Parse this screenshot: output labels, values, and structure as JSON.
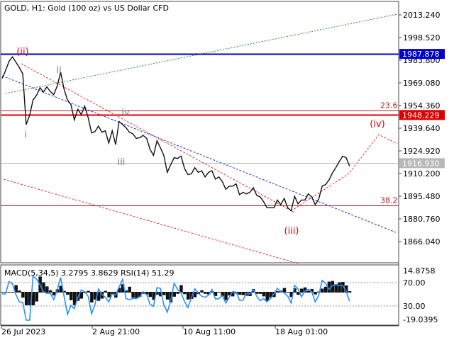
{
  "header": {
    "title": "GOLD, H1:  Gold (100 oz) vs US Dollar CFD"
  },
  "chart_data": [
    {
      "type": "line",
      "title": "GOLD, H1:  Gold (100 oz) vs US Dollar CFD",
      "ylim": [
        1856.0,
        2020.0
      ],
      "y_ticks": [
        "2013.240",
        "1998.520",
        "1983.800",
        "1969.080",
        "1954.360",
        "1939.640",
        "1924.920",
        "1910.200",
        "1895.480",
        "1880.760",
        "1866.040"
      ],
      "x_ticks": [
        "26 Jul 2023",
        "2 Aug 21:00",
        "10 Aug 11:00",
        "18 Aug 01:00"
      ],
      "price_tags": [
        {
          "label": "1987.878",
          "value": 1987.878,
          "color": "#0000cc"
        },
        {
          "label": "1948.229",
          "value": 1948.229,
          "color": "#dd0000"
        },
        {
          "label": "1916.930",
          "value": 1916.93,
          "color": "#b8b8b8"
        }
      ],
      "levels": [
        {
          "label": "23.6",
          "value": 1951.2
        },
        {
          "label": "38.2",
          "value": 1889.6
        }
      ],
      "wave_labels": [
        {
          "text": "(ii)",
          "color": "#dd0000"
        },
        {
          "text": "ii",
          "color": "#777777"
        },
        {
          "text": "i",
          "color": "#777777"
        },
        {
          "text": "iv",
          "color": "#777777"
        },
        {
          "text": "iii",
          "color": "#777777"
        },
        {
          "text": "(iii)",
          "color": "#dd0000"
        },
        {
          "text": "(iv)",
          "color": "#dd0000"
        }
      ],
      "series": [
        {
          "name": "GOLD H1",
          "x": [
            0,
            5,
            10,
            15,
            20,
            25,
            30,
            35,
            40,
            45,
            50,
            55,
            60,
            65,
            70,
            75,
            80,
            85,
            90,
            95,
            100,
            105,
            110,
            115,
            120,
            125,
            130,
            135,
            140,
            145,
            150,
            155,
            160,
            165,
            170,
            175,
            180,
            185,
            190,
            195,
            200,
            205,
            210,
            215,
            220,
            225,
            230,
            235,
            240,
            245,
            250,
            255,
            260,
            265,
            270,
            275,
            280,
            285,
            290,
            295,
            300,
            305,
            310,
            315,
            320,
            325,
            330,
            335,
            340,
            345,
            350,
            355,
            360,
            365,
            370,
            375,
            380,
            385,
            390,
            395,
            400,
            405,
            410,
            415,
            420,
            425,
            430,
            435,
            440,
            445,
            450,
            455,
            460,
            465,
            470,
            475,
            480,
            485,
            490,
            495,
            500,
            505
          ],
          "y": [
            1972.0,
            1977.0,
            1983.0,
            1986.0,
            1982.5,
            1979.0,
            1975.0,
            1942.0,
            1948.0,
            1958.0,
            1961.0,
            1966.0,
            1963.0,
            1966.5,
            1963.5,
            1961.5,
            1967.0,
            1976.0,
            1965.0,
            1958.0,
            1955.0,
            1945.0,
            1952.0,
            1948.5,
            1954.0,
            1946.5,
            1936.5,
            1937.5,
            1941.0,
            1937.0,
            1938.0,
            1930.0,
            1938.0,
            1929.0,
            1944.0,
            1942.0,
            1940.0,
            1937.0,
            1936.0,
            1933.0,
            1933.5,
            1935.0,
            1933.0,
            1926.0,
            1922.0,
            1931.5,
            1927.0,
            1922.0,
            1911.0,
            1916.0,
            1920.5,
            1920.0,
            1921.5,
            1913.5,
            1909.5,
            1910.0,
            1914.0,
            1911.0,
            1912.0,
            1908.0,
            1911.0,
            1912.0,
            1906.5,
            1908.0,
            1905.0,
            1900.0,
            1902.0,
            1902.0,
            1903.5,
            1896.5,
            1898.0,
            1897.0,
            1898.0,
            1901.0,
            1896.0,
            1895.0,
            1892.0,
            1888.0,
            1888.0,
            1888.0,
            1893.0,
            1890.0,
            1894.0,
            1888.0,
            1886.0,
            1895.5,
            1890.5,
            1893.0,
            1893.0,
            1897.0,
            1895.0,
            1890.0,
            1893.5,
            1902.0,
            1903.0,
            1906.0,
            1910.5,
            1914.0,
            1918.0,
            1921.5,
            1920.5,
            1915.0
          ]
        }
      ],
      "indicator": {
        "label": "MACD(5,34,5) 3.2795 3.8629 RSI(14) 51.29",
        "y_ticks": [
          "14.8758",
          "70.00",
          "30.00",
          "-19.0395"
        ]
      }
    }
  ]
}
